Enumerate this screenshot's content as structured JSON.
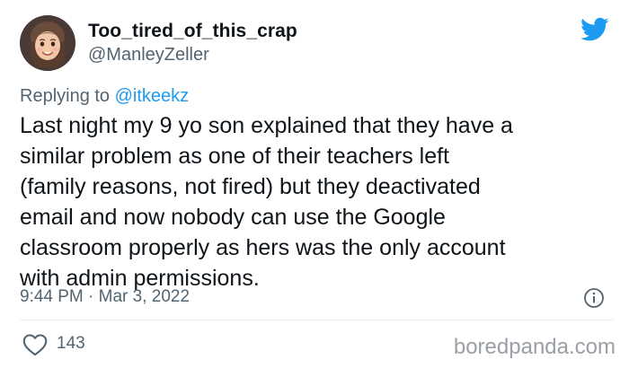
{
  "tweet": {
    "display_name": "Too_tired_of_this_crap",
    "handle": "@ManleyZeller",
    "replying_prefix": "Replying to",
    "replying_to": "@itkeekz",
    "text": "Last night my 9 yo son explained that they have a\nsimilar problem as one of their teachers left\n(family reasons, not fired) but they deactivated\nemail and now nobody can use the Google\nclassroom properly as hers was the only account\nwith admin permissions.",
    "time": "9:44 PM",
    "separator": "·",
    "date": "Mar 3, 2022",
    "like_count": "143"
  },
  "icons": {
    "platform": "twitter-bird-icon",
    "info": "info-icon",
    "like": "heart-icon"
  },
  "watermark": "boredpanda.com",
  "colors": {
    "twitter_blue": "#1d9bf0",
    "text": "#0f1419",
    "muted": "#536471",
    "divider": "#e6ecf0"
  }
}
